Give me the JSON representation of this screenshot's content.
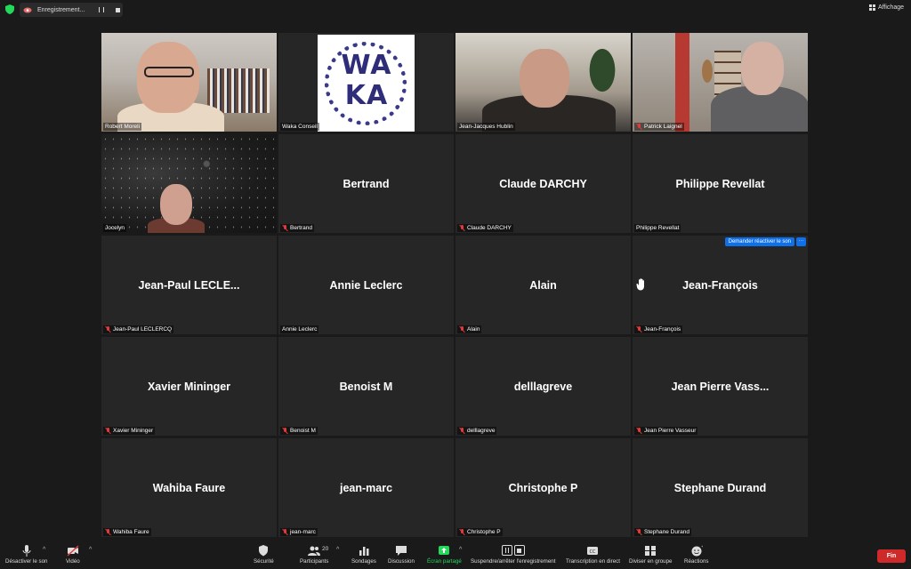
{
  "topbar": {
    "recording_label": "Enregistrement...",
    "view_label": "Affichage"
  },
  "tiles": [
    {
      "name": "Robert Moreli",
      "type": "video",
      "video": "robert",
      "muted": false,
      "active": true
    },
    {
      "name": "Waka Conseil",
      "type": "logo",
      "video": "waka",
      "muted": false,
      "logo_text": "WA KA"
    },
    {
      "name": "Jean-Jacques Hublin",
      "type": "video",
      "video": "jj",
      "muted": false
    },
    {
      "name": "Patrick Laignel",
      "type": "video",
      "video": "patrick",
      "muted": true
    },
    {
      "name": "Jocelyn",
      "type": "video",
      "video": "jocelyn",
      "muted": false
    },
    {
      "name": "Bertrand",
      "display": "Bertrand",
      "type": "name",
      "muted": true
    },
    {
      "name": "Claude DARCHY",
      "display": "Claude DARCHY",
      "type": "name",
      "muted": true
    },
    {
      "name": "Philippe Revellat",
      "display": "Philippe Revellat",
      "type": "name",
      "muted": false
    },
    {
      "name": "Jean-Paul LECLERCQ",
      "display": "Jean-Paul  LECLE...",
      "type": "name",
      "muted": true
    },
    {
      "name": "Annie Leclerc",
      "display": "Annie Leclerc",
      "type": "name",
      "muted": false
    },
    {
      "name": "Alain",
      "display": "Alain",
      "type": "name",
      "muted": true
    },
    {
      "name": "Jean-François",
      "display": "Jean-François",
      "type": "name",
      "muted": true,
      "hand_raised": true,
      "unmute_request": "Demander réactiver le son",
      "more": "···"
    },
    {
      "name": "Xavier Mininger",
      "display": "Xavier Mininger",
      "type": "name",
      "muted": true
    },
    {
      "name": "Benoist M",
      "display": "Benoist M",
      "type": "name",
      "muted": true
    },
    {
      "name": "delllagreve",
      "display": "delllagreve",
      "type": "name",
      "muted": true
    },
    {
      "name": "Jean Pierre Vasseur",
      "display": "Jean Pierre Vass...",
      "type": "name",
      "muted": true
    },
    {
      "name": "Wahiba Faure",
      "display": "Wahiba Faure",
      "type": "name",
      "muted": true
    },
    {
      "name": "jean-marc",
      "display": "jean-marc",
      "type": "name",
      "muted": true
    },
    {
      "name": "Christophe P",
      "display": "Christophe P",
      "type": "name",
      "muted": true
    },
    {
      "name": "Stephane Durand",
      "display": "Stephane Durand",
      "type": "name",
      "muted": true
    }
  ],
  "toolbar": {
    "mute_label": "Désactiver le son",
    "video_label": "Vidéo",
    "security_label": "Sécurité",
    "participants_label": "Participants",
    "participants_count": "20",
    "polls_label": "Sondages",
    "chat_label": "Discussion",
    "share_label": "Écran partagé",
    "record_label": "Suspendre/arrêter l'enregistrement",
    "transcript_label": "Transcription en direct",
    "breakout_label": "Diviser en groupe",
    "reactions_label": "Réactions",
    "end_label": "Fin"
  },
  "colors": {
    "active_speaker": "#c9e36b",
    "mute_red": "#e23a3a",
    "share_green": "#23d959",
    "end_red": "#cf2a2a",
    "request_blue": "#0e71eb"
  }
}
